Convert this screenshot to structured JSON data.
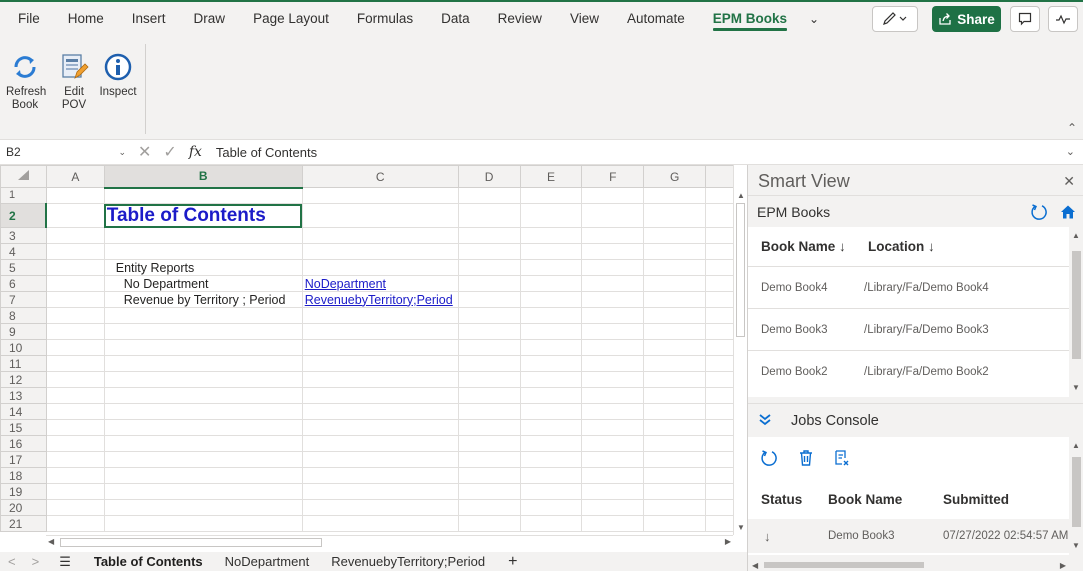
{
  "ribbon_tabs": [
    "File",
    "Home",
    "Insert",
    "Draw",
    "Page Layout",
    "Formulas",
    "Data",
    "Review",
    "View",
    "Automate",
    "EPM Books"
  ],
  "active_tab": "EPM Books",
  "share_label": "Share",
  "ribbon_buttons": {
    "refresh": "Refresh Book",
    "edit_pov": "Edit POV",
    "inspect": "Inspect"
  },
  "formula_bar": {
    "name_box": "B2",
    "formula": "Table of Contents"
  },
  "columns": [
    "A",
    "B",
    "C",
    "D",
    "E",
    "F",
    "G"
  ],
  "selected_column": "B",
  "rows": [
    "1",
    "2",
    "3",
    "4",
    "5",
    "6",
    "7",
    "8",
    "9",
    "10",
    "11",
    "12",
    "13",
    "14",
    "15",
    "16",
    "17",
    "18",
    "19",
    "20",
    "21"
  ],
  "selected_row": "2",
  "cells": {
    "B2": "Table of Contents",
    "B5": "Entity Reports",
    "B6": "No Department",
    "B7": "Revenue by Territory ; Period",
    "C6": "NoDepartment",
    "C7": "RevenuebyTerritory;Period"
  },
  "sheet_tabs": [
    "Table of Contents",
    "NoDepartment",
    "RevenuebyTerritory;Period"
  ],
  "active_sheet": "Table of Contents",
  "smart_view": {
    "title": "Smart View",
    "books_section": "EPM Books",
    "books_headers": {
      "name": "Book Name ↓",
      "location": "Location ↓"
    },
    "books": [
      {
        "name": "Demo Book4",
        "location": "/Library/Fa/Demo Book4"
      },
      {
        "name": "Demo Book3",
        "location": "/Library/Fa/Demo Book3"
      },
      {
        "name": "Demo Book2",
        "location": "/Library/Fa/Demo Book2"
      }
    ],
    "jobs_section": "Jobs Console",
    "jobs_headers": {
      "status": "Status",
      "book": "Book Name",
      "submitted": "Submitted"
    },
    "jobs": [
      {
        "status": "↓",
        "book": "Demo Book3",
        "submitted": "07/27/2022 02:54:57 AM"
      }
    ]
  },
  "colors": {
    "excel_green": "#217346",
    "link_blue": "#1b1bc8",
    "sv_blue": "#0a6ed1"
  }
}
